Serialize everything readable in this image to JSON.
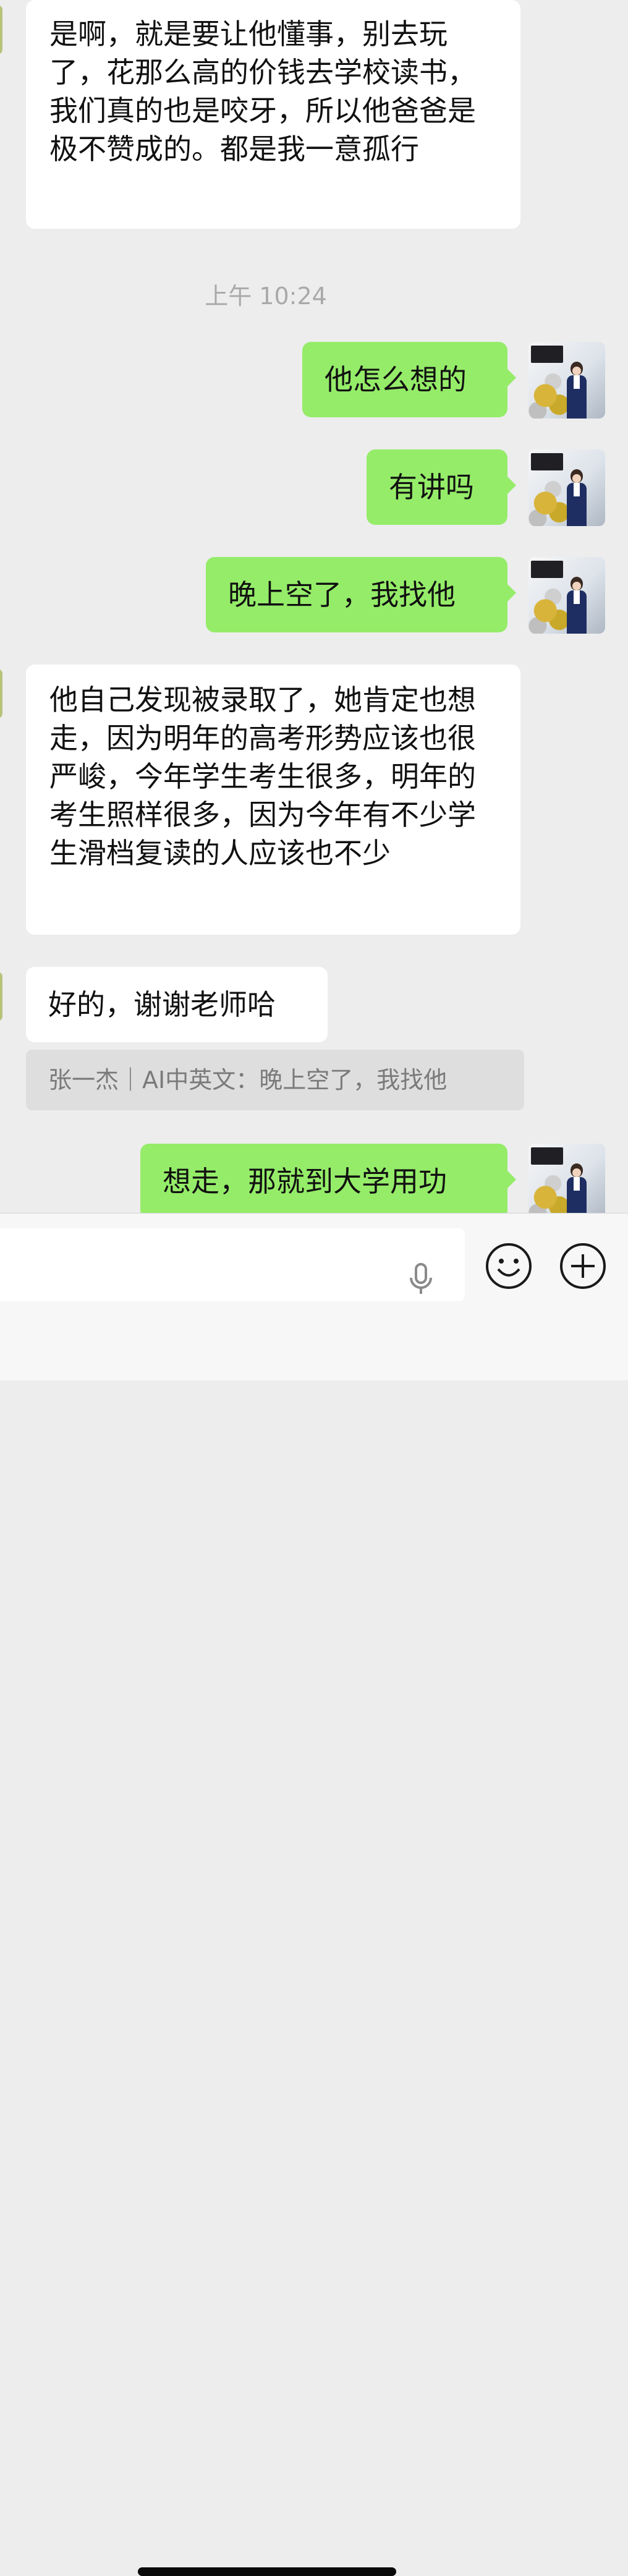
{
  "conversation": {
    "messages": [
      {
        "text": "是啊，就是要让他懂事，别去玩了，花那么高的价钱去学校读书，我们真的也是咬牙，所以他爸爸是极不赞成的。都是我一意孤行"
      },
      {
        "timestamp": "上午 10:24"
      },
      {
        "text": "他怎么想的"
      },
      {
        "text": "有讲吗"
      },
      {
        "text": "晚上空了，我找他"
      },
      {
        "text": "他自己发现被录取了，她肯定也想走，因为明年的高考形势应该也很严峻，今年学生考生很多，明年的考生照样很多，因为今年有不少学生滑档复读的人应该也不少"
      },
      {
        "text": "好的，谢谢老师哈"
      },
      {
        "quote": "张一杰｜AI中英文：晚上空了，我找他"
      },
      {
        "text": "想走，那就到大学用功"
      }
    ]
  },
  "input_bar": {
    "icons": {
      "voice": "microphone-icon",
      "emoji": "emoji-icon",
      "more": "plus-icon"
    }
  },
  "colors": {
    "background": "#ededed",
    "incoming_bubble": "#ffffff",
    "outgoing_bubble": "#95ec69",
    "timestamp_text": "#a9a9a9",
    "quote_background": "#dedede"
  }
}
